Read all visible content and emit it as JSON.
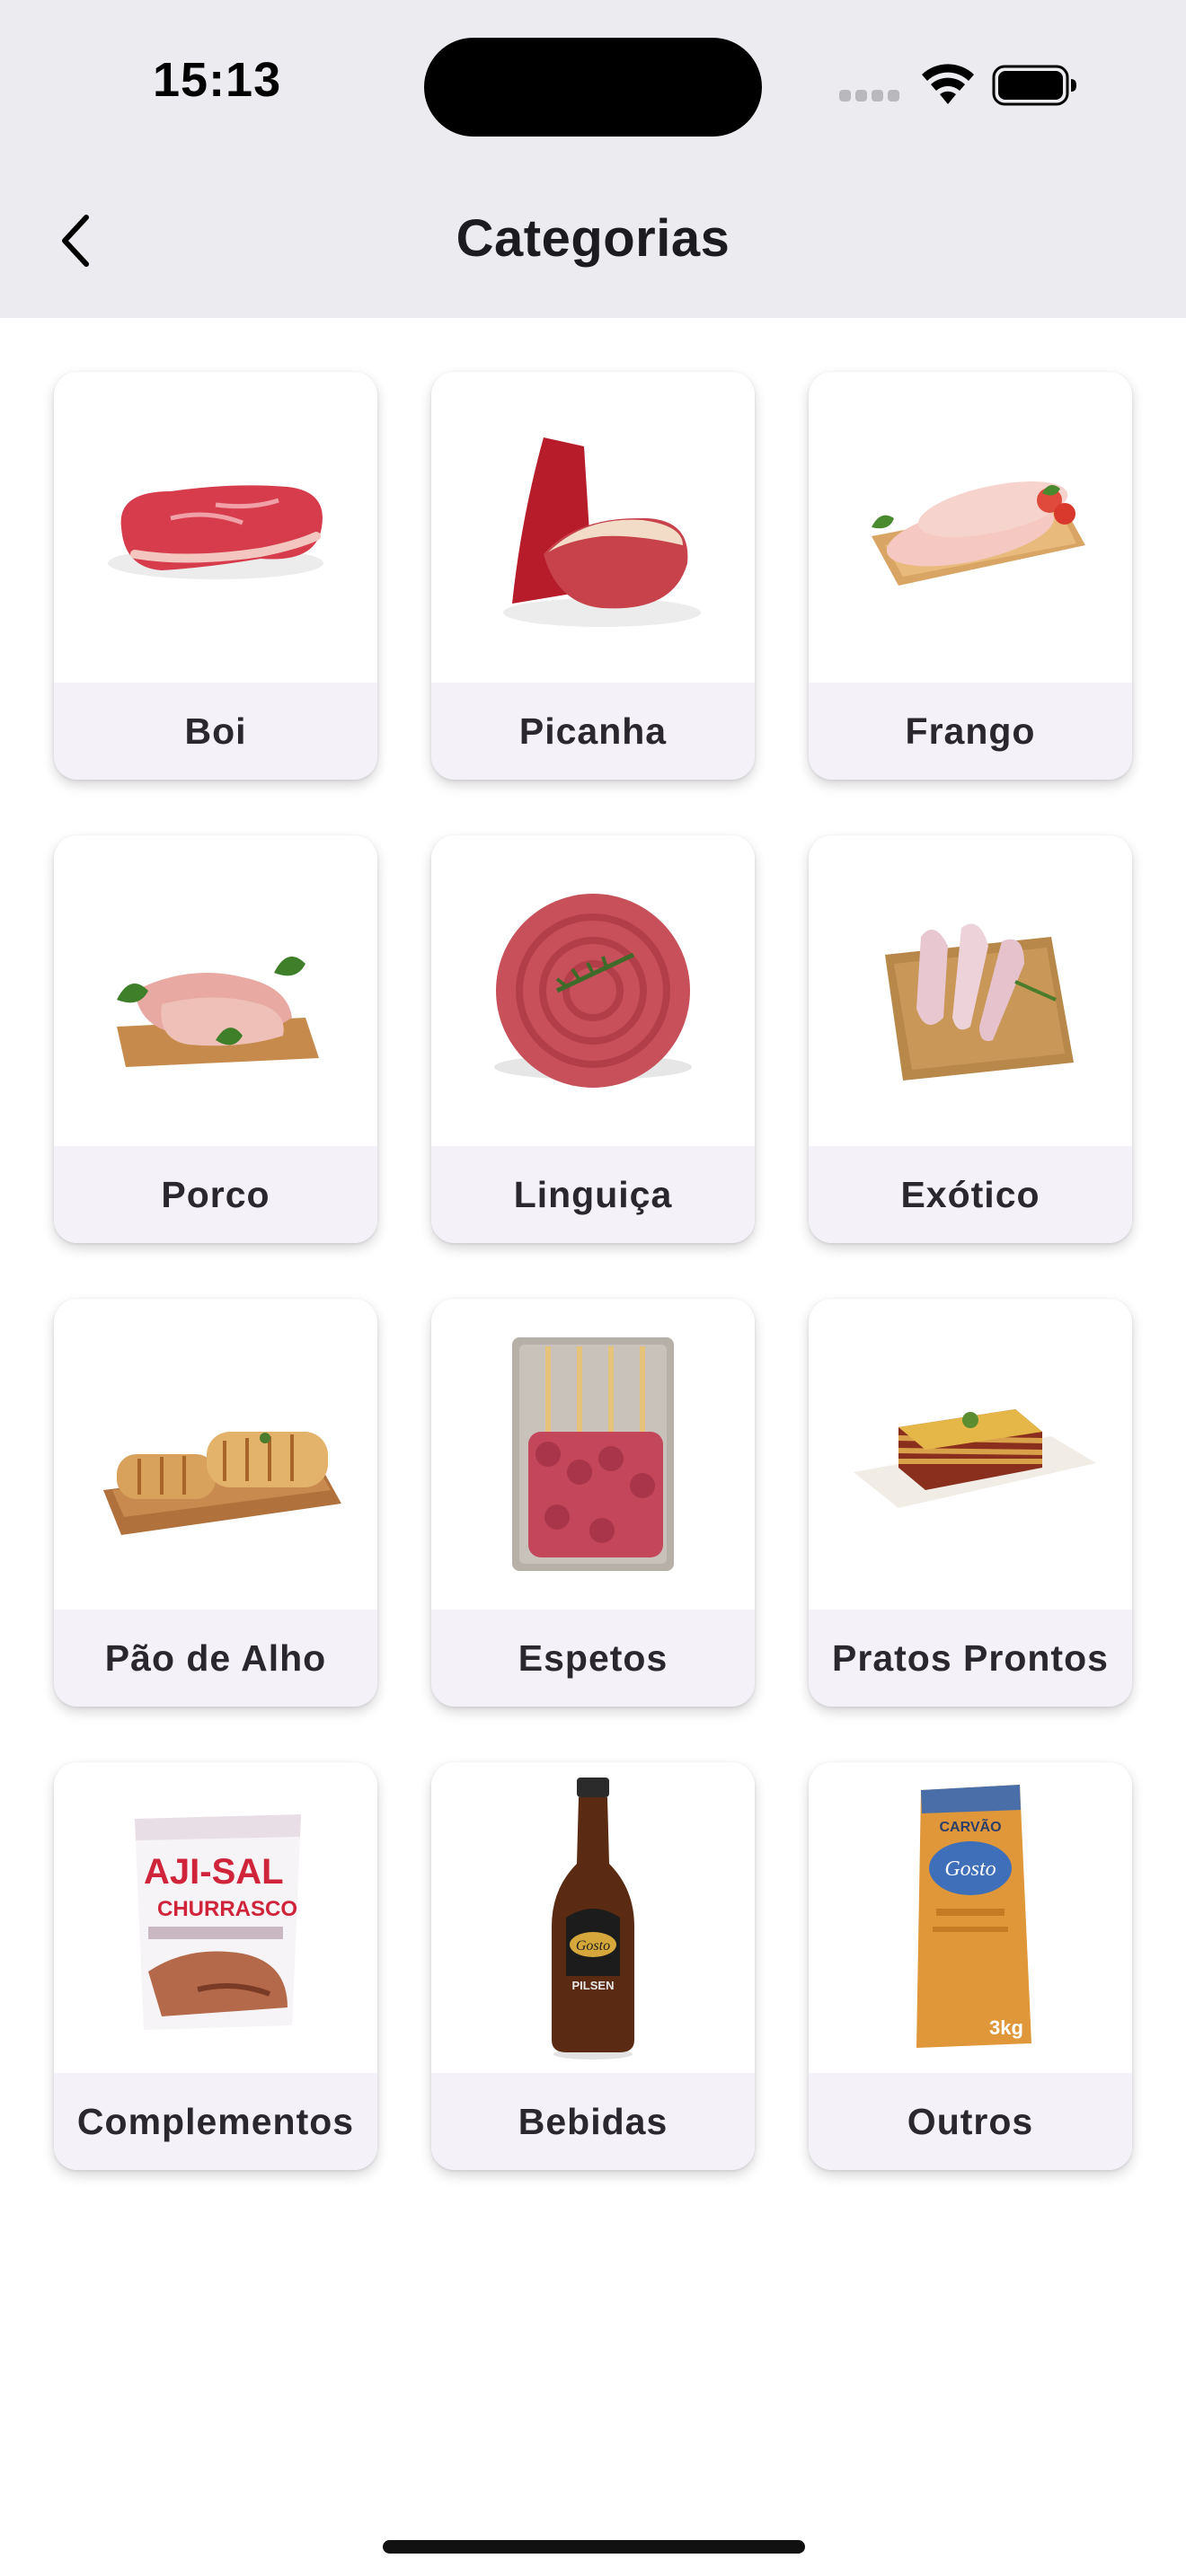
{
  "status_bar": {
    "time": "15:13"
  },
  "header": {
    "title": "Categorias",
    "back_icon": "chevron-left-icon"
  },
  "categories": [
    {
      "label": "Boi",
      "icon": "beef-steak-image"
    },
    {
      "label": "Picanha",
      "icon": "picanha-cut-image"
    },
    {
      "label": "Frango",
      "icon": "chicken-breast-image"
    },
    {
      "label": "Porco",
      "icon": "pork-chops-image"
    },
    {
      "label": "Linguiça",
      "icon": "sausage-coil-image"
    },
    {
      "label": "Exótico",
      "icon": "exotic-meat-image"
    },
    {
      "label": "Pão de Alho",
      "icon": "garlic-bread-image"
    },
    {
      "label": "Espetos",
      "icon": "skewers-pack-image"
    },
    {
      "label": "Pratos Prontos",
      "icon": "lasagna-dish-image"
    },
    {
      "label": "Complementos",
      "icon": "salt-bag-image",
      "package_text": [
        "AJI-SAL",
        "CHURRASCO"
      ]
    },
    {
      "label": "Bebidas",
      "icon": "beer-bottle-image",
      "bottle_text": [
        "Gosto",
        "PILSEN"
      ]
    },
    {
      "label": "Outros",
      "icon": "charcoal-bag-image",
      "package_text": [
        "CARVÃO",
        "Gosto",
        "3kg"
      ]
    }
  ]
}
